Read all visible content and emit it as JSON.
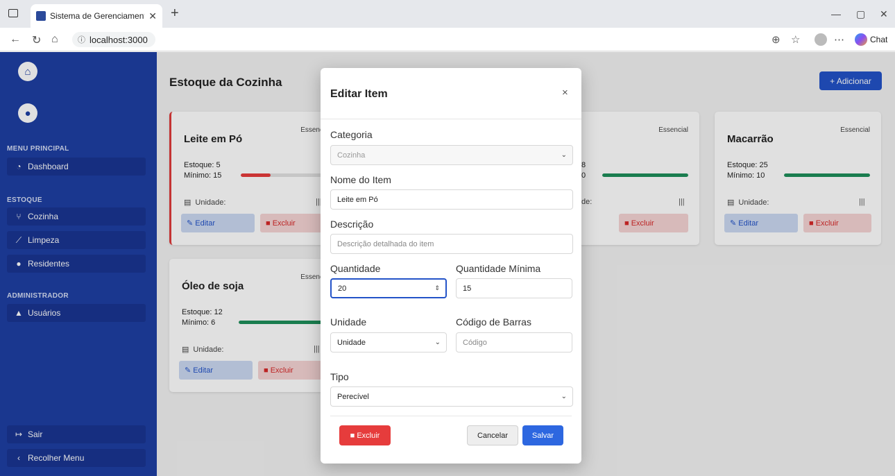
{
  "browser": {
    "tab_title": "Sistema de Gerenciamento de Est",
    "url": "localhost:3000",
    "chat_label": "Chat"
  },
  "sidebar": {
    "sections": {
      "main": "MENU PRINCIPAL",
      "stock": "ESTOQUE",
      "admin": "ADMINISTRADOR"
    },
    "items": [
      {
        "label": "Dashboard",
        "icon": "dashboard-icon"
      },
      {
        "label": "Cozinha",
        "icon": "utensils-icon"
      },
      {
        "label": "Limpeza",
        "icon": "broom-icon"
      },
      {
        "label": "Residentes",
        "icon": "users-icon"
      },
      {
        "label": "Usuários",
        "icon": "warning-icon"
      }
    ],
    "footer": [
      {
        "label": "Sair",
        "icon": "logout-icon"
      },
      {
        "label": "Recolher Menu",
        "icon": "chevron-left-icon"
      }
    ]
  },
  "page": {
    "title": "Estoque da Cozinha",
    "add_button": "+ Adicionar"
  },
  "cards": [
    {
      "name": "Leite em Pó",
      "badge": "Essencial",
      "stock": "Estoque: 5",
      "min": "Mínimo: 15",
      "fill": 0.33,
      "status": "low",
      "unit_label": "Unidade:",
      "edit": "Editar",
      "delete": "Excluir"
    },
    {
      "name": "",
      "badge": "Essencial",
      "stock": "8",
      "min": "0",
      "fill": 1.0,
      "status": "ok",
      "unit_label": "de:",
      "edit": "",
      "delete": "Excluir"
    },
    {
      "name": "Macarrão",
      "badge": "Essencial",
      "stock": "Estoque: 25",
      "min": "Mínimo: 10",
      "fill": 1.0,
      "status": "ok",
      "unit_label": "Unidade:",
      "edit": "Editar",
      "delete": "Excluir"
    },
    {
      "name": "Óleo de soja",
      "badge": "Essencial",
      "stock": "Estoque: 12",
      "min": "Mínimo: 6",
      "fill": 1.0,
      "status": "ok",
      "unit_label": "Unidade:",
      "edit": "Editar",
      "delete": "Excluir"
    }
  ],
  "colors": {
    "sidebar": "#1e3fa3",
    "primary": "#2353c8",
    "danger": "#e63c3c",
    "success": "#1e8f5a"
  },
  "modal": {
    "title": "Editar Item",
    "close": "×",
    "category_label": "Categoria",
    "category_value": "Cozinha",
    "name_label": "Nome do Item",
    "name_value": "Leite em Pó",
    "desc_label": "Descrição",
    "desc_placeholder": "Descrição detalhada do item",
    "qty_label": "Quantidade",
    "qty_value": "20",
    "minqty_label": "Quantidade Mínima",
    "minqty_value": "15",
    "unit_label": "Unidade",
    "unit_value": "Unidade",
    "barcode_label": "Código de Barras",
    "barcode_placeholder": "Código",
    "type_label": "Tipo",
    "type_value": "Perecível",
    "delete_button": "Excluir",
    "cancel_button": "Cancelar",
    "save_button": "Salvar"
  }
}
